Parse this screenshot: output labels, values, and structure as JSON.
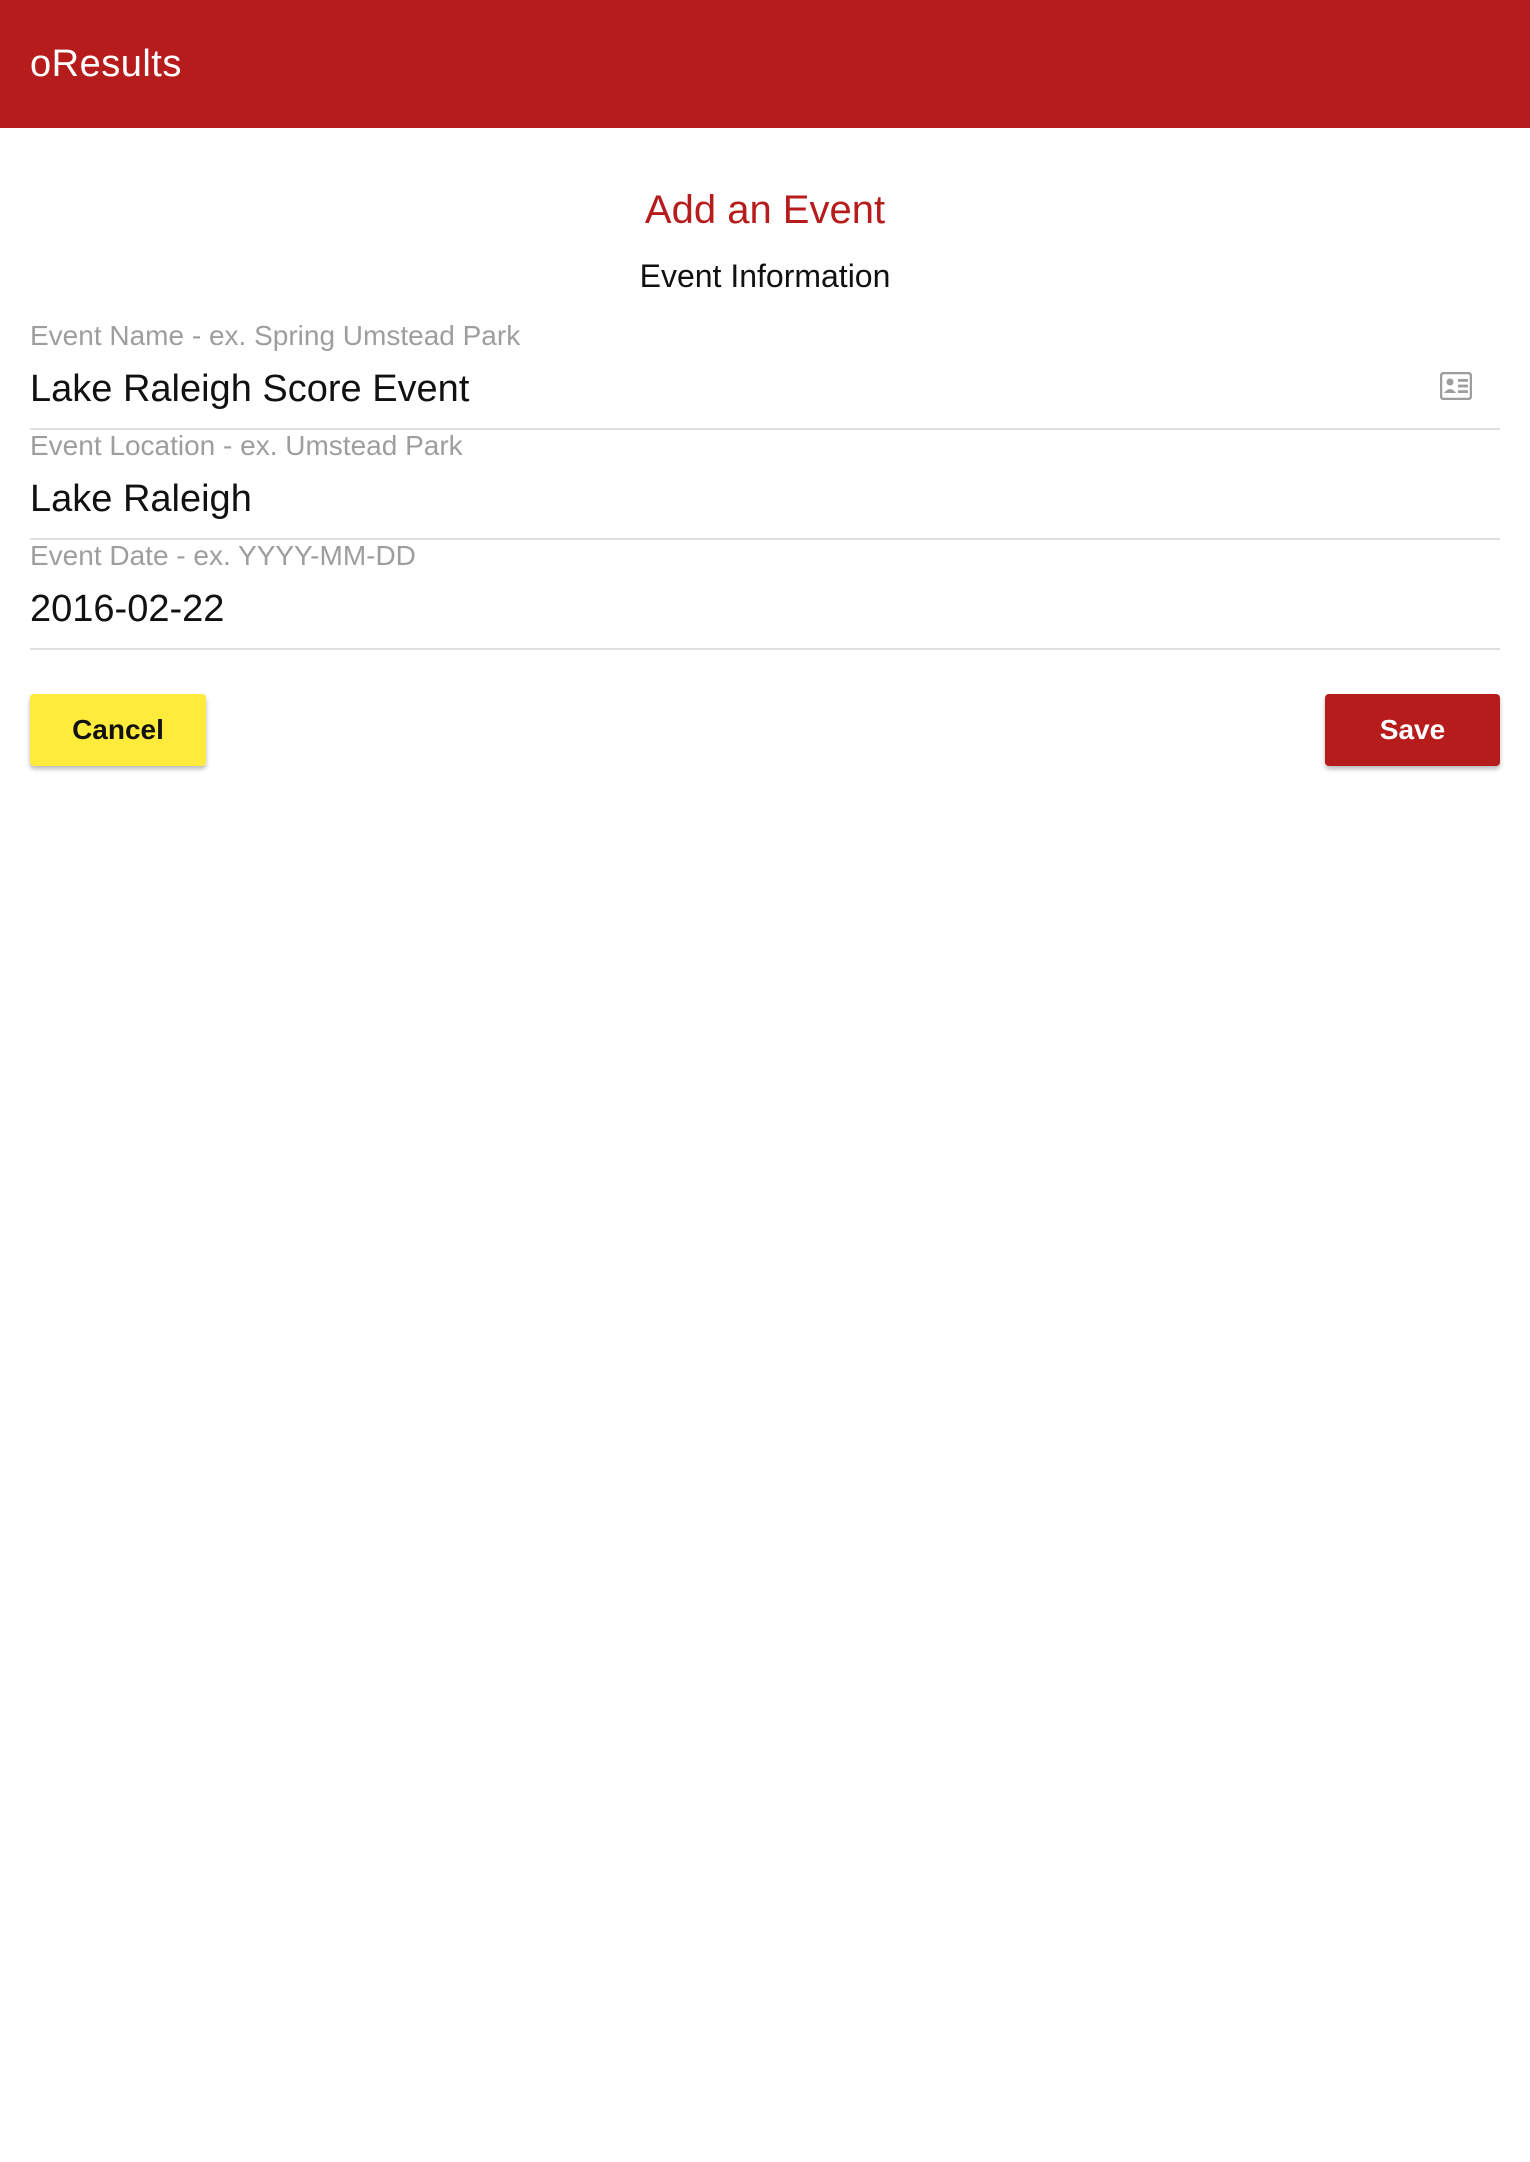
{
  "app": {
    "title": "oResults",
    "accent_color": "#b71c1c"
  },
  "form": {
    "heading": "Add an Event",
    "subheading": "Event Information",
    "fields": [
      {
        "label": "Event Name - ex. Spring Umstead Park",
        "value": "Lake Raleigh Score Event",
        "icon": "contact-card-icon"
      },
      {
        "label": "Event Location - ex. Umstead Park",
        "value": "Lake Raleigh"
      },
      {
        "label": "Event Date - ex. YYYY-MM-DD",
        "value": "2016-02-22"
      }
    ]
  },
  "actions": {
    "cancel_label": "Cancel",
    "cancel_color": "#ffeb3b",
    "save_label": "Save",
    "save_color": "#b71c1c"
  }
}
